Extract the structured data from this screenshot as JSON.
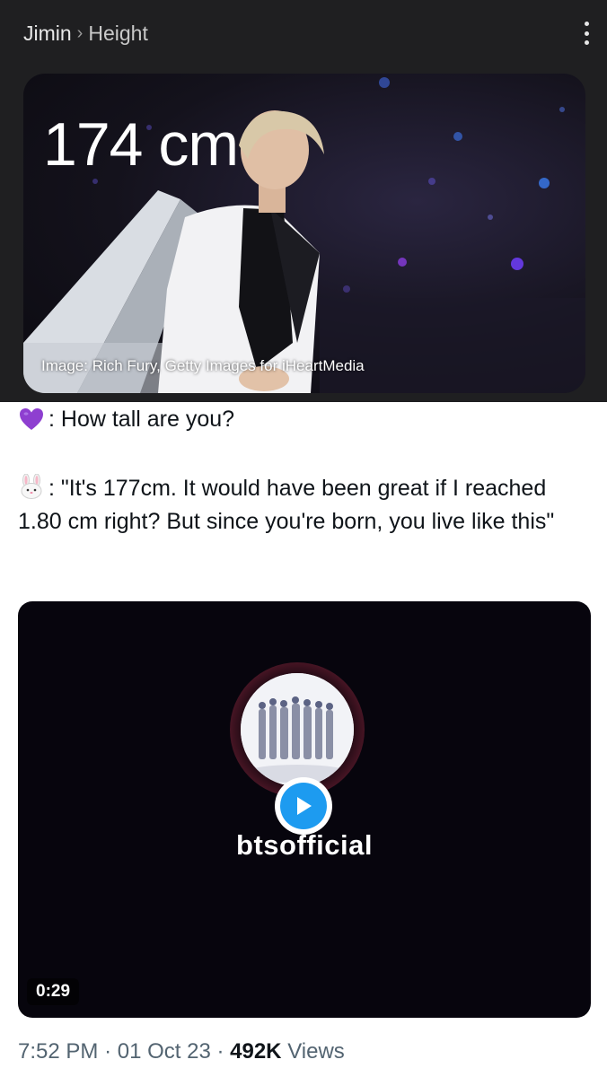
{
  "header": {
    "breadcrumb_parent": "Jimin",
    "breadcrumb_separator": "›",
    "breadcrumb_current": "Height",
    "menu_icon": "more-vert-icon"
  },
  "answer_card": {
    "height_value": "174 cm",
    "image_credit": "Image: Rich Fury, Getty Images for iHeartMedia"
  },
  "tweet": {
    "question_emoji": "purple-heart-icon",
    "question_text": ": How tall are you?",
    "answer_emoji": "rabbit-face-icon",
    "answer_text": ": \"It's 177cm. It would have been great if I reached 1.80 cm right? But since you're born, you live like this\"",
    "video": {
      "channel_name": "btsofficial",
      "duration": "0:29",
      "play_icon": "play-icon"
    },
    "time": "7:52 PM",
    "date": "01 Oct 23",
    "separator": "·",
    "views_count": "492K",
    "views_label": "Views"
  },
  "colors": {
    "header_bg": "#1f1f21",
    "accent_blue": "#1d9bf0",
    "meta_gray": "#536471"
  }
}
